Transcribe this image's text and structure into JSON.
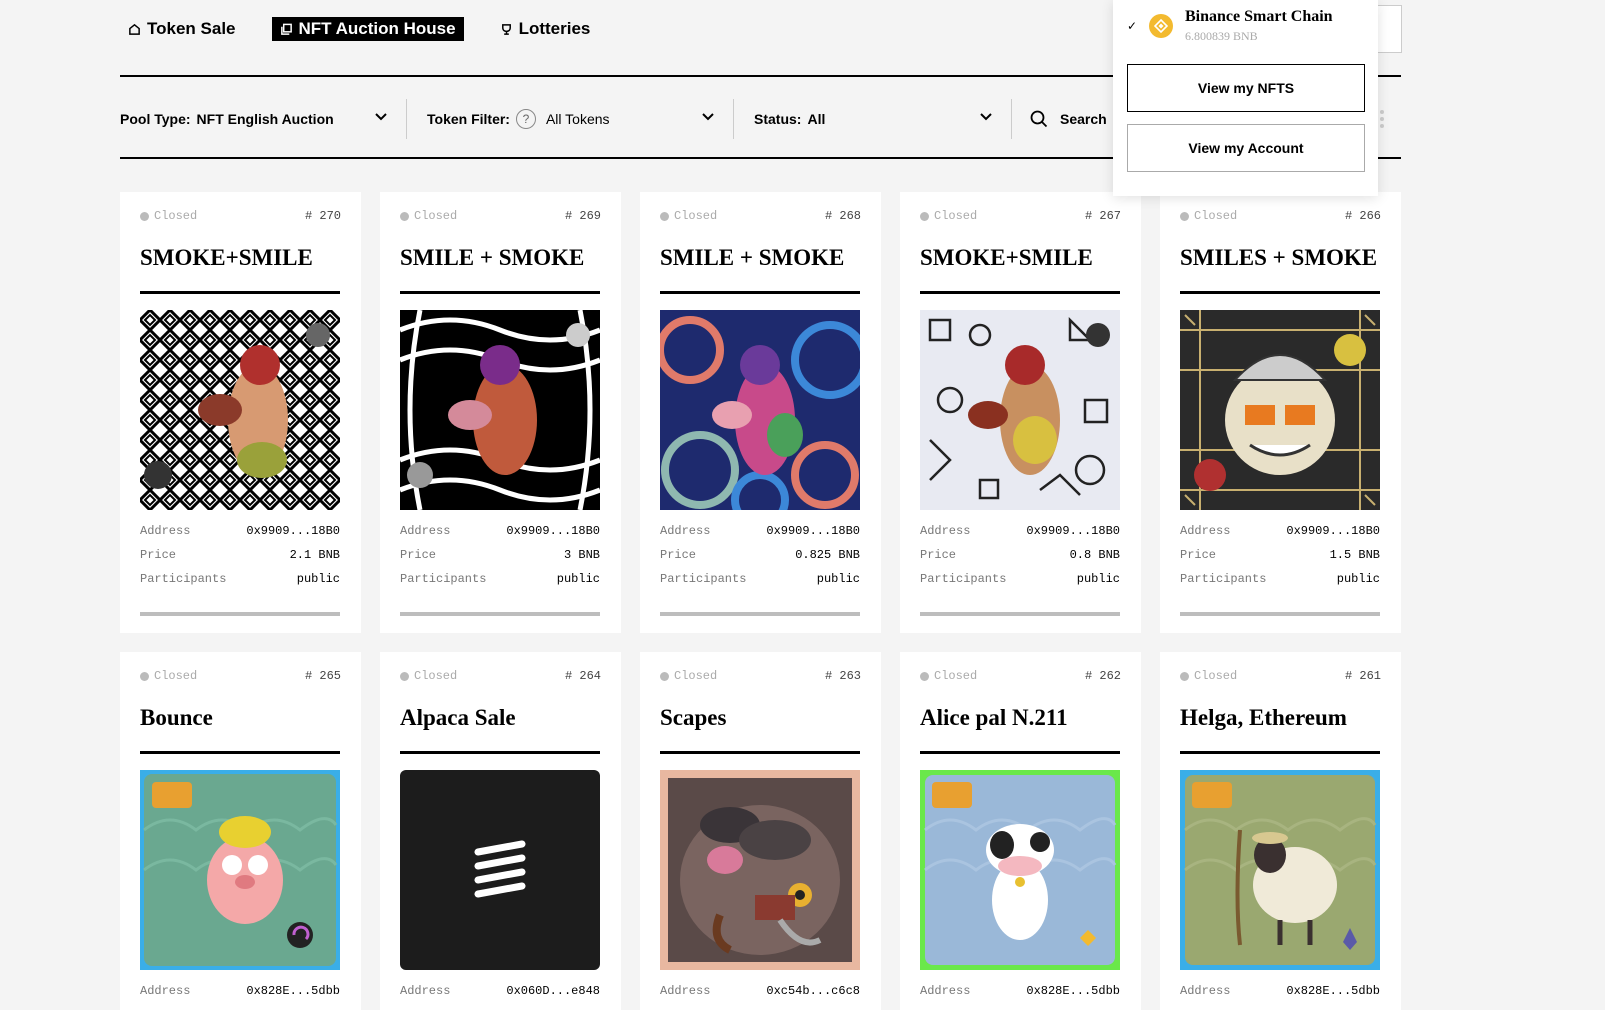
{
  "nav": {
    "items": [
      {
        "label": "Token Sale",
        "icon": "home-icon",
        "active": false
      },
      {
        "label": "NFT Auction House",
        "icon": "copy-icon",
        "active": true
      },
      {
        "label": "Lotteries",
        "icon": "trophy-icon",
        "active": false
      }
    ]
  },
  "filters": {
    "pool_label": "Pool Type:",
    "pool_value": "NFT English Auction",
    "token_label": "Token Filter:",
    "token_help": "?",
    "token_value": "All Tokens",
    "status_label": "Status:",
    "status_value": "All",
    "search_label": "Search"
  },
  "wallet_menu": {
    "chain_name": "Binance Smart Chain",
    "balance": "6.800839 BNB",
    "check": "✓",
    "view_nfts": "View my NFTS",
    "view_account": "View my Account"
  },
  "row_labels": {
    "address": "Address",
    "price": "Price",
    "participants": "Participants"
  },
  "cards": [
    {
      "status": "Closed",
      "num": "# 270",
      "title": "SMOKE+SMILE",
      "address": "0x9909...18B0",
      "price": "2.1 BNB",
      "participants": "public",
      "art": "bw-geometric"
    },
    {
      "status": "Closed",
      "num": "# 269",
      "title": "SMILE + SMOKE",
      "address": "0x9909...18B0",
      "price": "3 BNB",
      "participants": "public",
      "art": "bw-waves"
    },
    {
      "status": "Closed",
      "num": "# 268",
      "title": "SMILE + SMOKE",
      "address": "0x9909...18B0",
      "price": "0.825 BNB",
      "participants": "public",
      "art": "color-swirls"
    },
    {
      "status": "Closed",
      "num": "# 267",
      "title": "SMOKE+SMILE",
      "address": "0x9909...18B0",
      "price": "0.8 BNB",
      "participants": "public",
      "art": "doodle-pattern"
    },
    {
      "status": "Closed",
      "num": "# 266",
      "title": "SMILES + SMOKE",
      "address": "0x9909...18B0",
      "price": "1.5 BNB",
      "participants": "public",
      "art": "tribal-pattern"
    },
    {
      "status": "Closed",
      "num": "# 265",
      "title": "Bounce",
      "address": "0x828E...5dbb",
      "art": "pig-character"
    },
    {
      "status": "Closed",
      "num": "# 264",
      "title": "Alpaca Sale",
      "address": "0x060D...e848",
      "art": "dark-logo"
    },
    {
      "status": "Closed",
      "num": "# 263",
      "title": "Scapes",
      "address": "0xc54b...c6c8",
      "art": "monster-portrait"
    },
    {
      "status": "Closed",
      "num": "# 262",
      "title": "Alice pal N.211",
      "address": "0x828E...5dbb",
      "art": "cow-character"
    },
    {
      "status": "Closed",
      "num": "# 261",
      "title": "Helga, Ethereum",
      "address": "0x828E...5dbb",
      "art": "sheep-character"
    }
  ]
}
